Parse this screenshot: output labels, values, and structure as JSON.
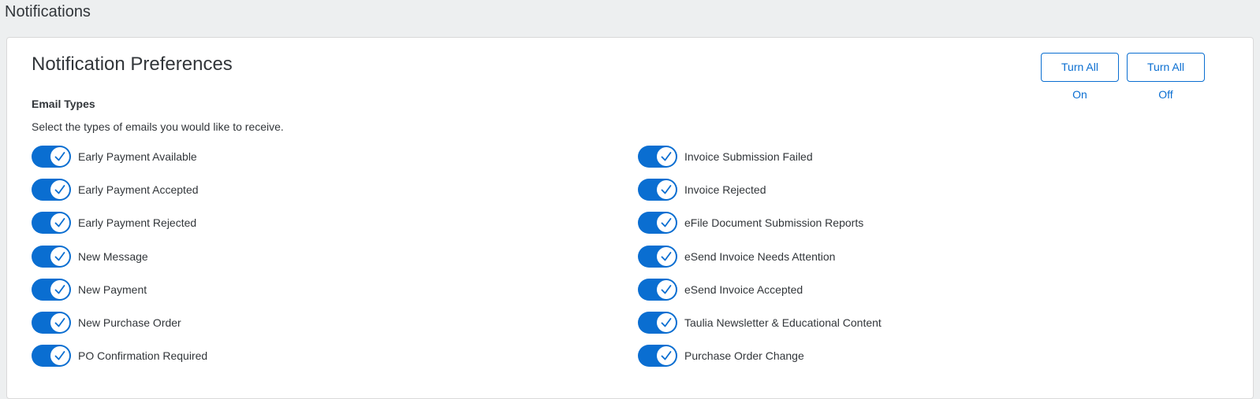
{
  "page": {
    "title": "Notifications"
  },
  "card": {
    "title": "Notification Preferences",
    "turn_all_on_label": "Turn All On",
    "turn_all_off_label": "Turn All Off"
  },
  "email_types": {
    "label": "Email Types",
    "description": "Select the types of emails you would like to receive.",
    "left": [
      {
        "label": "Early Payment Available",
        "enabled": true
      },
      {
        "label": "Early Payment Accepted",
        "enabled": true
      },
      {
        "label": "Early Payment Rejected",
        "enabled": true
      },
      {
        "label": "New Message",
        "enabled": true
      },
      {
        "label": "New Payment",
        "enabled": true
      },
      {
        "label": "New Purchase Order",
        "enabled": true
      },
      {
        "label": "PO Confirmation Required",
        "enabled": true
      }
    ],
    "right": [
      {
        "label": "Invoice Submission Failed",
        "enabled": true
      },
      {
        "label": "Invoice Rejected",
        "enabled": true
      },
      {
        "label": "eFile Document Submission Reports",
        "enabled": true
      },
      {
        "label": "eSend Invoice Needs Attention",
        "enabled": true
      },
      {
        "label": "eSend Invoice Accepted",
        "enabled": true
      },
      {
        "label": "Taulia Newsletter & Educational Content",
        "enabled": true
      },
      {
        "label": "Purchase Order Change",
        "enabled": true
      }
    ]
  },
  "colors": {
    "accent": "#0a6ed1",
    "background": "#edeff0",
    "text": "#32363a"
  },
  "icons": {
    "toggle_on": "check-icon"
  }
}
